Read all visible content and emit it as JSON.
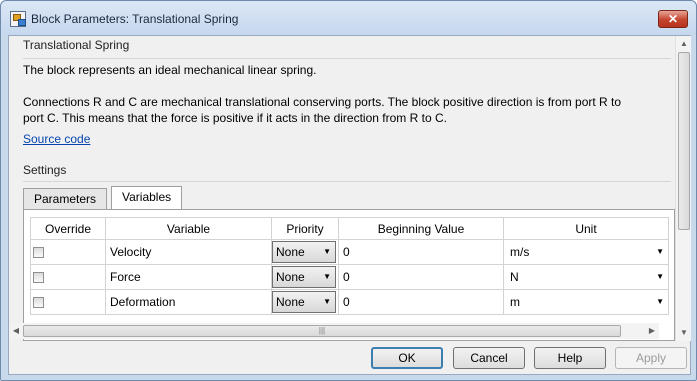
{
  "window": {
    "title": "Block Parameters: Translational Spring",
    "close_label": "✕"
  },
  "description": {
    "group_title": "Translational Spring",
    "line1": "The block represents an ideal mechanical linear spring.",
    "line2a": "Connections R and C are mechanical translational conserving ports. The block positive direction is from port R to",
    "line2b": "port C. This means that the force is positive if it acts in the direction from R to C.",
    "source_link": "Source code"
  },
  "settings": {
    "group_title": "Settings",
    "tabs": [
      {
        "label": "Parameters",
        "active": false
      },
      {
        "label": "Variables",
        "active": true
      }
    ]
  },
  "table": {
    "headers": {
      "override": "Override",
      "variable": "Variable",
      "priority": "Priority",
      "beginning_value": "Beginning Value",
      "unit": "Unit"
    },
    "rows": [
      {
        "override": false,
        "variable": "Velocity",
        "priority": "None",
        "value": "0",
        "unit": "m/s"
      },
      {
        "override": false,
        "variable": "Force",
        "priority": "None",
        "value": "0",
        "unit": "N"
      },
      {
        "override": false,
        "variable": "Deformation",
        "priority": "None",
        "value": "0",
        "unit": "m"
      }
    ]
  },
  "buttons": {
    "ok": "OK",
    "cancel": "Cancel",
    "help": "Help",
    "apply": "Apply"
  },
  "icons": {
    "dropdown": "chevron-down-icon",
    "scroll_grip": "|||"
  }
}
